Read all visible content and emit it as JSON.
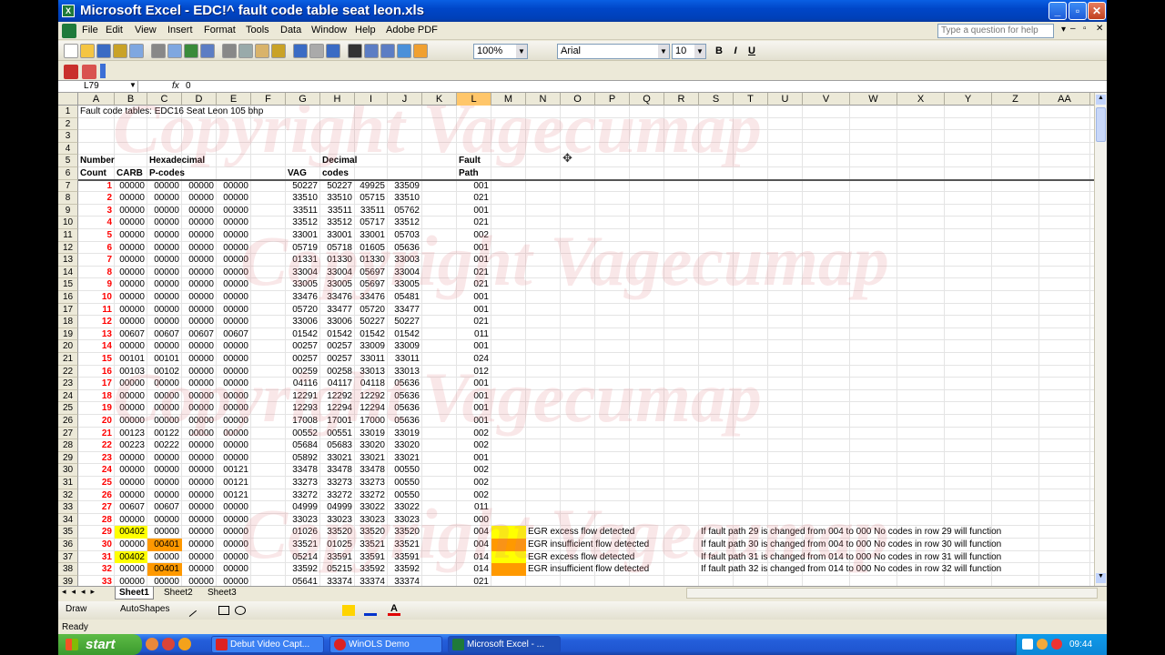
{
  "window": {
    "title": "Microsoft Excel - EDC!^ fault code table seat leon.xls",
    "app_icon": "X"
  },
  "menu": {
    "items": [
      "File",
      "Edit",
      "View",
      "Insert",
      "Format",
      "Tools",
      "Data",
      "Window",
      "Help",
      "Adobe PDF"
    ],
    "help_placeholder": "Type a question for help"
  },
  "toolbar": {
    "zoom": "100%",
    "font": "Arial",
    "font_size": "10",
    "bold": "B",
    "italic": "I",
    "underline": "U",
    "sigma": "Σ"
  },
  "formula": {
    "name_box": "L79",
    "fx": "fx",
    "value": "0"
  },
  "columns": [
    "A",
    "B",
    "C",
    "D",
    "E",
    "F",
    "G",
    "H",
    "I",
    "J",
    "K",
    "L",
    "M",
    "N",
    "O",
    "P",
    "Q",
    "R",
    "S",
    "T",
    "U",
    "V",
    "W",
    "X",
    "Y",
    "Z",
    "AA"
  ],
  "rows": {
    "numbers": [
      "1",
      "2",
      "3",
      "4",
      "5",
      "6",
      "7",
      "8",
      "9",
      "10",
      "11",
      "12",
      "13",
      "14",
      "15",
      "16",
      "17",
      "18",
      "19",
      "20",
      "21",
      "22",
      "23",
      "24",
      "25",
      "26",
      "27",
      "28",
      "29",
      "30",
      "31",
      "32",
      "33",
      "34",
      "35",
      "36",
      "37",
      "38",
      "39"
    ],
    "title": "Fault code tables: EDC16 Seat Leon 105 bhp",
    "headers5": {
      "a": "Number",
      "c": "Hexadecimal",
      "h": "Decimal",
      "l": "Fault"
    },
    "headers6": {
      "a": "Count",
      "b": "CARB",
      "c": "P-codes",
      "g": "VAG",
      "h": "codes",
      "l": "Path"
    },
    "data": [
      [
        "1",
        "00000",
        "00000",
        "00000",
        "00000",
        "50227",
        "50227",
        "49925",
        "33509",
        "001"
      ],
      [
        "2",
        "00000",
        "00000",
        "00000",
        "00000",
        "33510",
        "33510",
        "05715",
        "33510",
        "021"
      ],
      [
        "3",
        "00000",
        "00000",
        "00000",
        "00000",
        "33511",
        "33511",
        "33511",
        "05762",
        "001"
      ],
      [
        "4",
        "00000",
        "00000",
        "00000",
        "00000",
        "33512",
        "33512",
        "05717",
        "33512",
        "021"
      ],
      [
        "5",
        "00000",
        "00000",
        "00000",
        "00000",
        "33001",
        "33001",
        "33001",
        "05703",
        "002"
      ],
      [
        "6",
        "00000",
        "00000",
        "00000",
        "00000",
        "05719",
        "05718",
        "01605",
        "05636",
        "001"
      ],
      [
        "7",
        "00000",
        "00000",
        "00000",
        "00000",
        "01331",
        "01330",
        "01330",
        "33003",
        "001"
      ],
      [
        "8",
        "00000",
        "00000",
        "00000",
        "00000",
        "33004",
        "33004",
        "05697",
        "33004",
        "021"
      ],
      [
        "9",
        "00000",
        "00000",
        "00000",
        "00000",
        "33005",
        "33005",
        "05697",
        "33005",
        "021"
      ],
      [
        "10",
        "00000",
        "00000",
        "00000",
        "00000",
        "33476",
        "33476",
        "33476",
        "05481",
        "001"
      ],
      [
        "11",
        "00000",
        "00000",
        "00000",
        "00000",
        "05720",
        "33477",
        "05720",
        "33477",
        "001"
      ],
      [
        "12",
        "00000",
        "00000",
        "00000",
        "00000",
        "33006",
        "33006",
        "50227",
        "50227",
        "021"
      ],
      [
        "13",
        "00607",
        "00607",
        "00607",
        "00607",
        "01542",
        "01542",
        "01542",
        "01542",
        "011"
      ],
      [
        "14",
        "00000",
        "00000",
        "00000",
        "00000",
        "00257",
        "00257",
        "33009",
        "33009",
        "001"
      ],
      [
        "15",
        "00101",
        "00101",
        "00000",
        "00000",
        "00257",
        "00257",
        "33011",
        "33011",
        "024"
      ],
      [
        "16",
        "00103",
        "00102",
        "00000",
        "00000",
        "00259",
        "00258",
        "33013",
        "33013",
        "012"
      ],
      [
        "17",
        "00000",
        "00000",
        "00000",
        "00000",
        "04116",
        "04117",
        "04118",
        "05636",
        "001"
      ],
      [
        "18",
        "00000",
        "00000",
        "00000",
        "00000",
        "12291",
        "12292",
        "12292",
        "05636",
        "001"
      ],
      [
        "19",
        "00000",
        "00000",
        "00000",
        "00000",
        "12293",
        "12294",
        "12294",
        "05636",
        "001"
      ],
      [
        "20",
        "00000",
        "00000",
        "00000",
        "00000",
        "17008",
        "17001",
        "17000",
        "05636",
        "001"
      ],
      [
        "21",
        "00123",
        "00122",
        "00000",
        "00000",
        "00552",
        "00551",
        "33019",
        "33019",
        "002"
      ],
      [
        "22",
        "00223",
        "00222",
        "00000",
        "00000",
        "05684",
        "05683",
        "33020",
        "33020",
        "002"
      ],
      [
        "23",
        "00000",
        "00000",
        "00000",
        "00000",
        "05892",
        "33021",
        "33021",
        "33021",
        "001"
      ],
      [
        "24",
        "00000",
        "00000",
        "00000",
        "00121",
        "33478",
        "33478",
        "33478",
        "00550",
        "002"
      ],
      [
        "25",
        "00000",
        "00000",
        "00000",
        "00121",
        "33273",
        "33273",
        "33273",
        "00550",
        "002"
      ],
      [
        "26",
        "00000",
        "00000",
        "00000",
        "00121",
        "33272",
        "33272",
        "33272",
        "00550",
        "002"
      ],
      [
        "27",
        "00607",
        "00607",
        "00000",
        "00000",
        "04999",
        "04999",
        "33022",
        "33022",
        "011"
      ],
      [
        "28",
        "00000",
        "00000",
        "00000",
        "00000",
        "33023",
        "33023",
        "33023",
        "33023",
        "000"
      ],
      [
        "29",
        "00402",
        "00000",
        "00000",
        "00000",
        "01026",
        "33520",
        "33520",
        "33520",
        "004"
      ],
      [
        "30",
        "00000",
        "00401",
        "00000",
        "00000",
        "33521",
        "01025",
        "33521",
        "33521",
        "004"
      ],
      [
        "31",
        "00402",
        "00000",
        "00000",
        "00000",
        "05214",
        "33591",
        "33591",
        "33591",
        "014"
      ],
      [
        "32",
        "00000",
        "00401",
        "00000",
        "00000",
        "33592",
        "05215",
        "33592",
        "33592",
        "014"
      ],
      [
        "33",
        "00000",
        "00000",
        "00000",
        "00000",
        "05641",
        "33374",
        "33374",
        "33374",
        "021"
      ]
    ],
    "notes": [
      {
        "row": 35,
        "desc": "EGR excess flow detected",
        "comment": "If fault path 29 is changed from 004 to 000 No codes in row 29 will function"
      },
      {
        "row": 36,
        "desc": "EGR insufficient flow detected",
        "comment": "If fault path 30 is changed from 004 to 000 No codes in row 30 will function"
      },
      {
        "row": 37,
        "desc": "EGR excess flow detected",
        "comment": "If fault path 31 is changed from 014 to 000 No codes in row 31 will function"
      },
      {
        "row": 38,
        "desc": "EGR insufficient flow detected",
        "comment": "If fault path 32 is changed from 014 to 000 No codes in row 32 will function"
      }
    ]
  },
  "watermark": "Copyright Vagecumap",
  "sheets": [
    "Sheet1",
    "Sheet2",
    "Sheet3"
  ],
  "drawbar": {
    "draw": "Draw",
    "autoshapes": "AutoShapes"
  },
  "status": "Ready",
  "taskbar": {
    "start": "start",
    "tasks": [
      "Debut Video Capt...",
      "WinOLS Demo",
      "Microsoft Excel - ..."
    ],
    "clock": "09:44"
  },
  "colors": {
    "yellow": "#FFFF00",
    "orange": "#FF9900",
    "selected_col": "#FFC66A"
  }
}
